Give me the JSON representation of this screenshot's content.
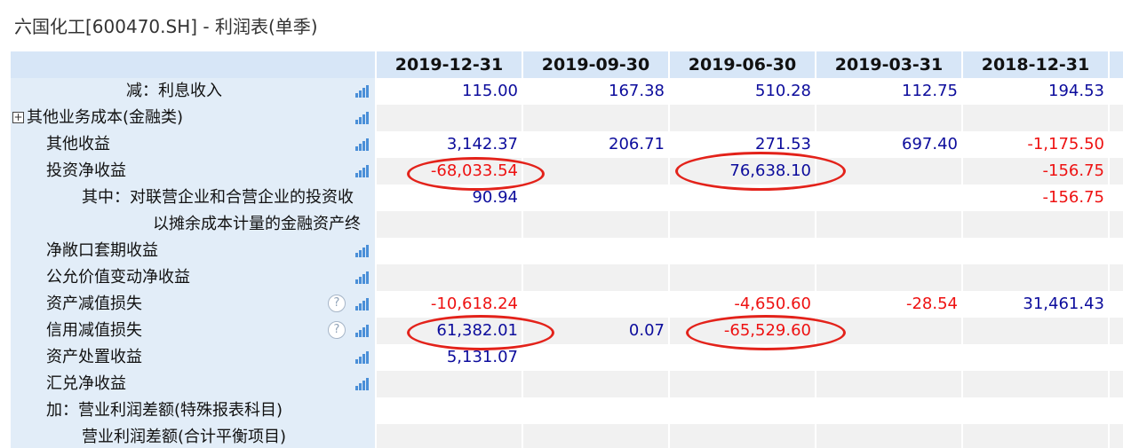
{
  "window": {
    "title": "六国化工[600470.SH] - 利润表(单季)"
  },
  "table": {
    "dates": [
      "2019-12-31",
      "2019-09-30",
      "2019-06-30",
      "2019-03-31",
      "2018-12-31"
    ],
    "rows": [
      {
        "label": "减：利息收入",
        "values": [
          "115.00",
          "167.38",
          "510.28",
          "112.75",
          "194.53"
        ]
      },
      {
        "label": "其他业务成本(金融类)",
        "values": [
          "",
          "",
          "",
          "",
          ""
        ]
      },
      {
        "label": "其他收益",
        "values": [
          "3,142.37",
          "206.71",
          "271.53",
          "697.40",
          "-1,175.50"
        ]
      },
      {
        "label": "投资净收益",
        "values": [
          "-68,033.54",
          "",
          "76,638.10",
          "",
          "-156.75"
        ]
      },
      {
        "label": "其中：对联营企业和合营企业的投资收",
        "values": [
          "90.94",
          "",
          "",
          "",
          "-156.75"
        ]
      },
      {
        "label": "以摊余成本计量的金融资产终",
        "values": [
          "",
          "",
          "",
          "",
          ""
        ]
      },
      {
        "label": "净敞口套期收益",
        "values": [
          "",
          "",
          "",
          "",
          ""
        ]
      },
      {
        "label": "公允价值变动净收益",
        "values": [
          "",
          "",
          "",
          "",
          ""
        ]
      },
      {
        "label": "资产减值损失",
        "values": [
          "-10,618.24",
          "",
          "-4,650.60",
          "-28.54",
          "31,461.43"
        ]
      },
      {
        "label": "信用减值损失",
        "values": [
          "61,382.01",
          "0.07",
          "-65,529.60",
          "",
          ""
        ]
      },
      {
        "label": "资产处置收益",
        "values": [
          "5,131.07",
          "",
          "",
          "",
          ""
        ]
      },
      {
        "label": "汇兑净收益",
        "values": [
          "",
          "",
          "",
          "",
          ""
        ]
      },
      {
        "label": "加：营业利润差额(特殊报表科目)",
        "values": [
          "",
          "",
          "",
          "",
          ""
        ]
      },
      {
        "label": "营业利润差额(合计平衡项目)",
        "values": [
          "",
          "",
          "",
          "",
          ""
        ]
      }
    ]
  },
  "help_symbol": "?",
  "expand_symbol": "+",
  "colors": {
    "header_bg": "#d7e6f7",
    "label_bg": "#e2edf8",
    "positive": "#0c0c9c",
    "negative": "#ee1111",
    "annotation": "#e3221a"
  }
}
